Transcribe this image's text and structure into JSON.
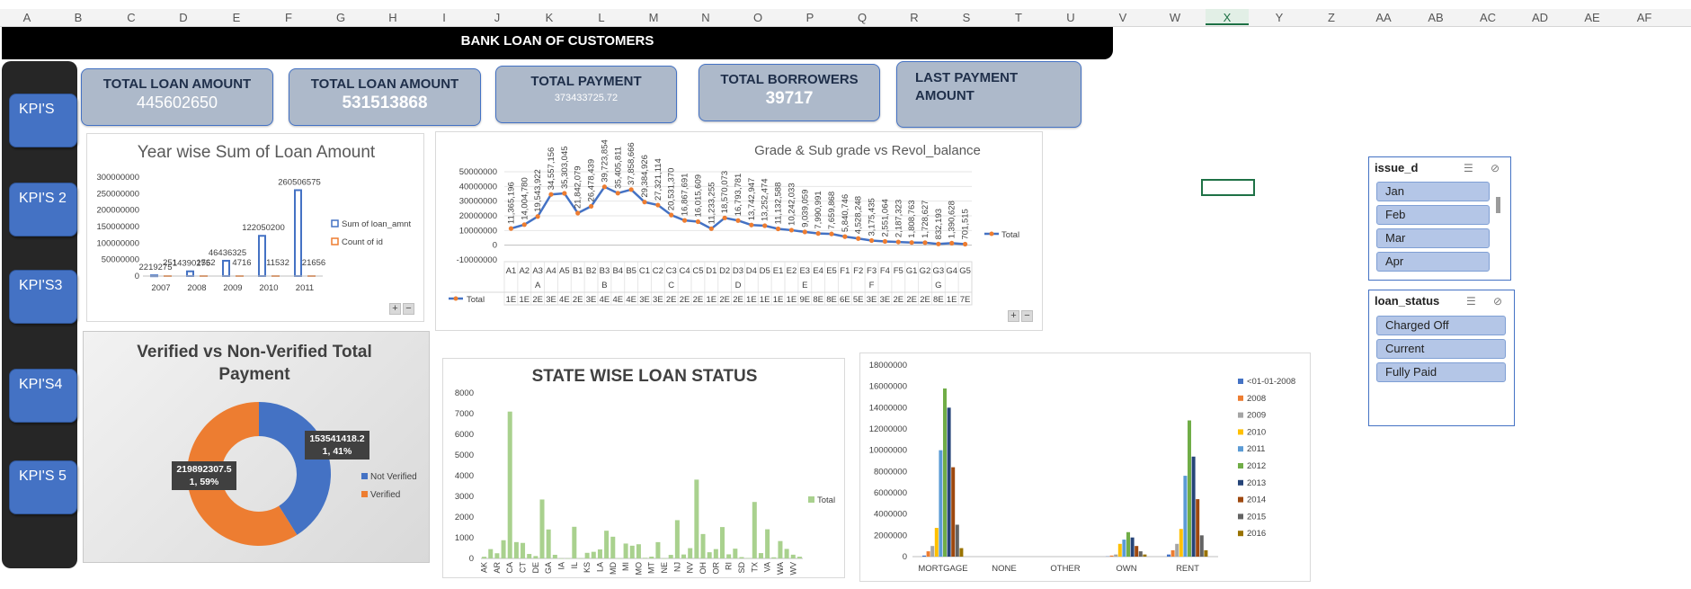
{
  "column_headers": [
    "A",
    "B",
    "C",
    "D",
    "E",
    "F",
    "G",
    "H",
    "I",
    "J",
    "K",
    "L",
    "M",
    "N",
    "O",
    "P",
    "Q",
    "R",
    "S",
    "T",
    "U",
    "V",
    "W",
    "X",
    "Y",
    "Z",
    "AA",
    "AB",
    "AC",
    "AD",
    "AE",
    "AF"
  ],
  "selected_column": "X",
  "banner_title": "BANK LOAN OF CUSTOMERS",
  "sidebar": {
    "items": [
      {
        "label": "KPI'S"
      },
      {
        "label": "KPI'S 2"
      },
      {
        "label": "KPI'S3"
      },
      {
        "label": "KPI'S4"
      },
      {
        "label": "KPI'S 5"
      }
    ]
  },
  "kpis": [
    {
      "label": "TOTAL LOAN AMOUNT",
      "value": "445602650"
    },
    {
      "label": "TOTAL LOAN AMOUNT",
      "value": "531513868"
    },
    {
      "label": "TOTAL PAYMENT",
      "value": "373433725.72"
    },
    {
      "label": "TOTAL BORROWERS",
      "value": "39717"
    },
    {
      "label": "LAST PAYMENT AMOUNT",
      "value": ""
    }
  ],
  "colors": {
    "accent": "#4472c4",
    "orange": "#ed7d31",
    "green": "#a9d18e",
    "sidebar": "#262626",
    "kpi_bg": "#adb9ca",
    "slicer_item": "#b4c6e7"
  },
  "chart_data": [
    {
      "type": "bar",
      "title": "Year wise Sum of Loan Amount",
      "categories": [
        "2007",
        "2008",
        "2009",
        "2010",
        "2011"
      ],
      "series": [
        {
          "name": "Sum of loan_amnt",
          "values": [
            2219275,
            14390275,
            46436325,
            122050200,
            260506575
          ]
        },
        {
          "name": "Count of id",
          "values": [
            251,
            1562,
            4716,
            11532,
            21656
          ]
        }
      ],
      "data_labels": [
        "2219275",
        "14390275",
        "46436325",
        "122050200",
        "260506575",
        "251",
        "1562",
        "4716",
        "11532",
        "21656"
      ],
      "ylim": [
        0,
        300000000
      ],
      "yticks": [
        "0",
        "50000000",
        "100000000",
        "150000000",
        "200000000",
        "250000000",
        "300000000"
      ],
      "legend": "right"
    },
    {
      "type": "line",
      "title": "Grade & Sub grade vs Revol_balance",
      "x": [
        "A1",
        "A2",
        "A3",
        "A4",
        "A5",
        "B1",
        "B2",
        "B3",
        "B4",
        "B5",
        "C1",
        "C2",
        "C3",
        "C4",
        "C5",
        "D1",
        "D2",
        "D3",
        "D4",
        "D5",
        "E1",
        "E2",
        "E3",
        "E4",
        "E5",
        "F1",
        "F2",
        "F3",
        "F4",
        "F5",
        "G1",
        "G2",
        "G3",
        "G4",
        "G5"
      ],
      "groups": [
        "A",
        "B",
        "C",
        "D",
        "E",
        "F",
        "G"
      ],
      "series": [
        {
          "name": "Total",
          "values": [
            11365196,
            14004780,
            19543922,
            34557156,
            35303045,
            21842079,
            26478439,
            39723854,
            35405811,
            37858666,
            29384926,
            27321114,
            20531370,
            16867691,
            16015609,
            11233255,
            18570073,
            16793781,
            13742947,
            13252474,
            11132588,
            10242033,
            9039059,
            7990991,
            7659868,
            5840746,
            4528248,
            3175435,
            2551064,
            2187323,
            1808763,
            1728627,
            832193,
            1390628,
            701515
          ]
        }
      ],
      "point_labels": [
        "11,365,196",
        "14,004,780",
        "19,543,922",
        "34,557,156",
        "35,303,045",
        "21,842,079",
        "26,478,439",
        "39,723,854",
        "35,405,811",
        "37,858,666",
        "29,384,926",
        "27,321,114",
        "20,531,370",
        "16,867,691",
        "16,015,609",
        "11,233,255",
        "18,570,073",
        "16,793,781",
        "13,742,947",
        "13,252,474",
        "11,132,588",
        "10,242,033",
        "9,039,059",
        "7,990,991",
        "7,659,868",
        "5,840,746",
        "4,528,248",
        "3,175,435",
        "2,551,064",
        "2,187,323",
        "1,808,763",
        "1,728,627",
        "832,193",
        "1,390,628",
        "701,515"
      ],
      "table_row": [
        "1E",
        "1E",
        "2E",
        "3E",
        "4E",
        "2E",
        "3E",
        "4E",
        "4E",
        "4E",
        "3E",
        "3E",
        "2E",
        "2E",
        "2E",
        "1E",
        "2E",
        "2E",
        "1E",
        "1E",
        "1E",
        "1E",
        "9E",
        "8E",
        "8E",
        "6E",
        "5E",
        "3E",
        "3E",
        "2E",
        "2E",
        "2E",
        "8E",
        "1E",
        "7E"
      ],
      "ylim": [
        -10000000,
        50000000
      ],
      "yticks": [
        "-10000000",
        "0",
        "10000000",
        "20000000",
        "30000000",
        "40000000",
        "50000000"
      ],
      "legend": "right"
    },
    {
      "type": "pie",
      "title": "Verified vs Non-Verified Total Payment",
      "slices": [
        {
          "name": "Not Verified",
          "value": 153541418.2,
          "label": "153541418.2",
          "sublabel": "1, 41%"
        },
        {
          "name": "Verified",
          "value": 219892307.5,
          "label": "219892307.5",
          "sublabel": "1, 59%"
        }
      ],
      "legend": "right"
    },
    {
      "type": "bar",
      "title": "STATE WISE LOAN STATUS",
      "categories": [
        "AK",
        "AL",
        "AR",
        "AZ",
        "CA",
        "CO",
        "CT",
        "DC",
        "DE",
        "FL",
        "GA",
        "HI",
        "IA",
        "ID",
        "IL",
        "IN",
        "KS",
        "KY",
        "LA",
        "MA",
        "MD",
        "ME",
        "MI",
        "MN",
        "MO",
        "MS",
        "MT",
        "NC",
        "NE",
        "NH",
        "NJ",
        "NM",
        "NV",
        "NY",
        "OH",
        "OK",
        "OR",
        "PA",
        "RI",
        "SC",
        "SD",
        "TN",
        "TX",
        "UT",
        "VA",
        "VT",
        "WA",
        "WI",
        "WV",
        "WY"
      ],
      "tick_labels": [
        "AK",
        "AR",
        "CA",
        "CT",
        "DE",
        "GA",
        "IA",
        "IL",
        "KS",
        "LA",
        "MD",
        "MI",
        "MO",
        "MT",
        "NE",
        "NJ",
        "NV",
        "OH",
        "OR",
        "RI",
        "SD",
        "TX",
        "VA",
        "WA",
        "WV"
      ],
      "series": [
        {
          "name": "Total",
          "values": [
            80,
            450,
            250,
            880,
            7100,
            790,
            750,
            215,
            114,
            2850,
            1400,
            175,
            5,
            6,
            1530,
            9,
            270,
            320,
            436,
            1340,
            1050,
            3,
            720,
            615,
            686,
            29,
            85,
            788,
            5,
            171,
            1850,
            190,
            497,
            3810,
            1180,
            299,
            451,
            1517,
            198,
            472,
            64,
            17,
            2730,
            258,
            1409,
            54,
            840,
            460,
            180,
            83
          ]
        }
      ],
      "ylim": [
        0,
        8000
      ],
      "yticks": [
        "0",
        "1000",
        "2000",
        "3000",
        "4000",
        "5000",
        "6000",
        "7000",
        "8000"
      ],
      "legend": "right"
    },
    {
      "type": "bar",
      "title": "",
      "categories": [
        "MORTGAGE",
        "NONE",
        "OTHER",
        "OWN",
        "RENT"
      ],
      "series": [
        {
          "name": "<01-01-2008",
          "values": [
            100000,
            0,
            0,
            20000,
            200000
          ]
        },
        {
          "name": "2008",
          "values": [
            500000,
            0,
            0,
            100000,
            600000
          ]
        },
        {
          "name": "2009",
          "values": [
            1000000,
            0,
            0,
            200000,
            1200000
          ]
        },
        {
          "name": "2010",
          "values": [
            2700000,
            0,
            0,
            1200000,
            2600000
          ]
        },
        {
          "name": "2011",
          "values": [
            10000000,
            0,
            0,
            1600000,
            7600000
          ]
        },
        {
          "name": "2012",
          "values": [
            15800000,
            0,
            0,
            2300000,
            12800000
          ]
        },
        {
          "name": "2013",
          "values": [
            14000000,
            0,
            0,
            1800000,
            9400000
          ]
        },
        {
          "name": "2014",
          "values": [
            8400000,
            0,
            0,
            1000000,
            5400000
          ]
        },
        {
          "name": "2015",
          "values": [
            3000000,
            0,
            0,
            500000,
            2000000
          ]
        },
        {
          "name": "2016",
          "values": [
            800000,
            0,
            0,
            200000,
            600000
          ]
        }
      ],
      "ylim": [
        0,
        18000000
      ],
      "yticks": [
        "0",
        "2000000",
        "4000000",
        "6000000",
        "8000000",
        "10000000",
        "12000000",
        "14000000",
        "16000000",
        "18000000"
      ],
      "legend": "right"
    }
  ],
  "slicers": [
    {
      "title": "issue_d",
      "items": [
        "Jan",
        "Feb",
        "Mar",
        "Apr"
      ]
    },
    {
      "title": "loan_status",
      "items": [
        "Charged Off",
        "Current",
        "Fully Paid"
      ]
    }
  ]
}
